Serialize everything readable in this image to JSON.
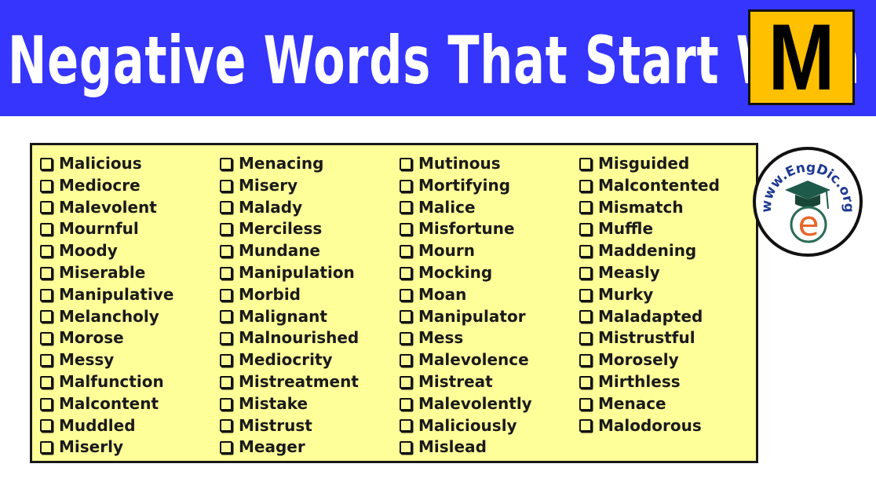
{
  "header": {
    "title": "Negative Words That Start With",
    "letter": "M",
    "colors": {
      "banner": "#3535fd",
      "letter_box": "#ffc000",
      "list_bg": "#ffff99"
    }
  },
  "columns": [
    [
      "Malicious",
      "Mediocre",
      "Malevolent",
      "Mournful",
      "Moody",
      "Miserable",
      "Manipulative",
      "Melancholy",
      "Morose",
      "Messy",
      "Malfunction",
      "Malcontent",
      "Muddled",
      "Miserly"
    ],
    [
      "Menacing",
      "Misery",
      "Malady",
      "Merciless",
      "Mundane",
      "Manipulation",
      "Morbid",
      "Malignant",
      "Malnourished",
      "Mediocrity",
      "Mistreatment",
      "Mistake",
      "Mistrust",
      "Meager"
    ],
    [
      "Mutinous",
      "Mortifying",
      "Malice",
      "Misfortune",
      "Mourn",
      "Mocking",
      "Moan",
      "Manipulator",
      "Mess",
      "Malevolence",
      "Mistreat",
      "Malevolently",
      "Maliciously",
      "Mislead"
    ],
    [
      "Misguided",
      "Malcontented",
      "Mismatch",
      "Muffle",
      "Maddening",
      "Measly",
      "Murky",
      "Maladapted",
      "Mistrustful",
      "Morosely",
      "Mirthless",
      "Menace",
      "Malodorous"
    ]
  ],
  "logo": {
    "text": "www.EngDic.org",
    "letter": "e"
  }
}
